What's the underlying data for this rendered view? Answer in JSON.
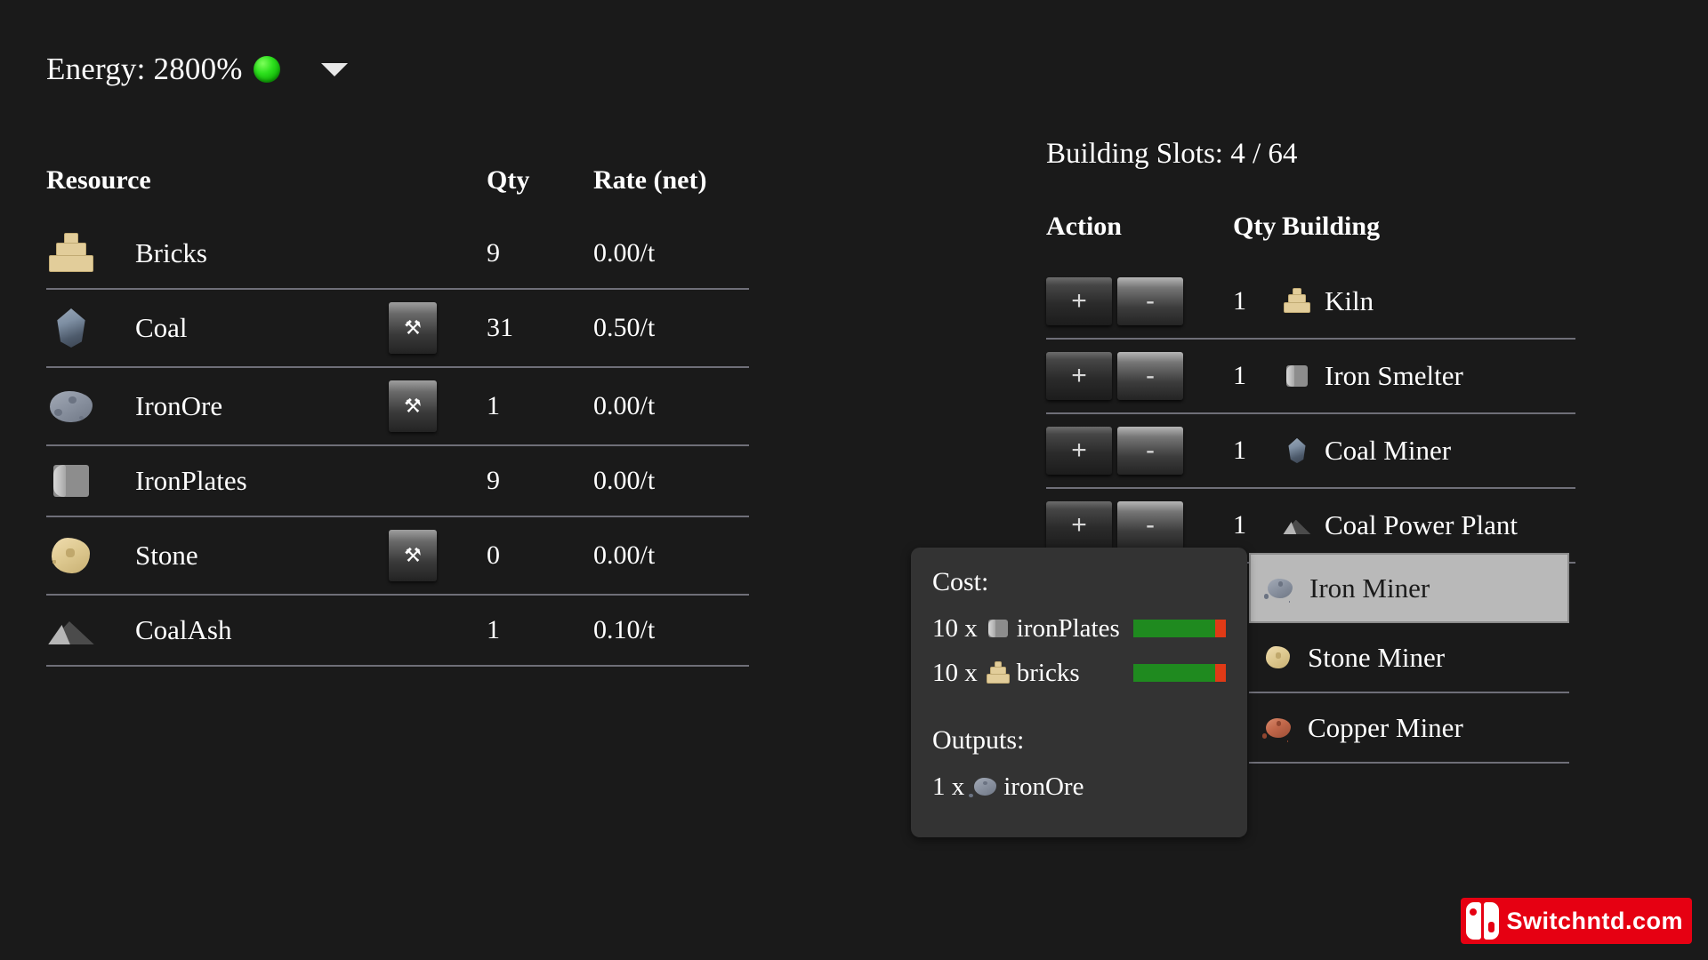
{
  "header": {
    "energy_label": "Energy: 2800%",
    "energy_status_color": "#2ee11e",
    "dropdown_icon": "chevron-down-icon"
  },
  "resource_table": {
    "columns": {
      "resource": "Resource",
      "qty": "Qty",
      "rate": "Rate (net)"
    },
    "rows": [
      {
        "icon": "bricks-icon",
        "name": "Bricks",
        "mineable": false,
        "mine_icon": "",
        "qty": "9",
        "rate": "0.00/t",
        "rate_positive": false
      },
      {
        "icon": "coal-icon",
        "name": "Coal",
        "mineable": true,
        "mine_icon": "pickaxe-icon",
        "qty": "31",
        "rate": "0.50/t",
        "rate_positive": true
      },
      {
        "icon": "iron-ore-icon",
        "name": "IronOre",
        "mineable": true,
        "mine_icon": "pickaxe-icon",
        "qty": "1",
        "rate": "0.00/t",
        "rate_positive": false
      },
      {
        "icon": "iron-plate-icon",
        "name": "IronPlates",
        "mineable": false,
        "mine_icon": "",
        "qty": "9",
        "rate": "0.00/t",
        "rate_positive": false
      },
      {
        "icon": "stone-icon",
        "name": "Stone",
        "mineable": true,
        "mine_icon": "pickaxe-icon",
        "qty": "0",
        "rate": "0.00/t",
        "rate_positive": false
      },
      {
        "icon": "coal-ash-icon",
        "name": "CoalAsh",
        "mineable": false,
        "mine_icon": "",
        "qty": "1",
        "rate": "0.10/t",
        "rate_positive": true
      }
    ],
    "mine_button_glyph": "⚒"
  },
  "building_panel": {
    "slots_label": "Building Slots: 4 / 64",
    "columns": {
      "action": "Action",
      "qty": "Qty",
      "building": "Building"
    },
    "increment_label": "+",
    "decrement_label": "-",
    "rows": [
      {
        "qty": "1",
        "icon": "bricks-icon",
        "name": "Kiln"
      },
      {
        "qty": "1",
        "icon": "iron-plate-icon",
        "name": "Iron Smelter"
      },
      {
        "qty": "1",
        "icon": "coal-icon",
        "name": "Coal Miner"
      },
      {
        "qty": "1",
        "icon": "coal-ash-icon",
        "name": "Coal Power Plant"
      }
    ]
  },
  "build_list": {
    "options": [
      {
        "icon": "iron-ore-icon",
        "name": "Iron Miner",
        "selected": true
      },
      {
        "icon": "stone-icon",
        "name": "Stone Miner",
        "selected": false
      },
      {
        "icon": "copper-icon",
        "name": "Copper Miner",
        "selected": false
      }
    ]
  },
  "tooltip": {
    "cost_heading": "Cost:",
    "costs": [
      {
        "qty": "10 x",
        "icon": "iron-plate-icon",
        "name": "ironPlates",
        "fill_percent": 88,
        "bar_fill_color": "#1f8a1f",
        "bar_empty_color": "#e03a16"
      },
      {
        "qty": "10 x",
        "icon": "bricks-icon",
        "name": "bricks",
        "fill_percent": 88,
        "bar_fill_color": "#1f8a1f",
        "bar_empty_color": "#e03a16"
      }
    ],
    "outputs_heading": "Outputs:",
    "outputs": [
      {
        "qty": "1 x",
        "icon": "iron-ore-icon",
        "name": "ironOre"
      }
    ]
  },
  "watermark": {
    "text": "Switchntd.com",
    "brand_color": "#e60012",
    "logo": "nintendo-switch-logo"
  }
}
